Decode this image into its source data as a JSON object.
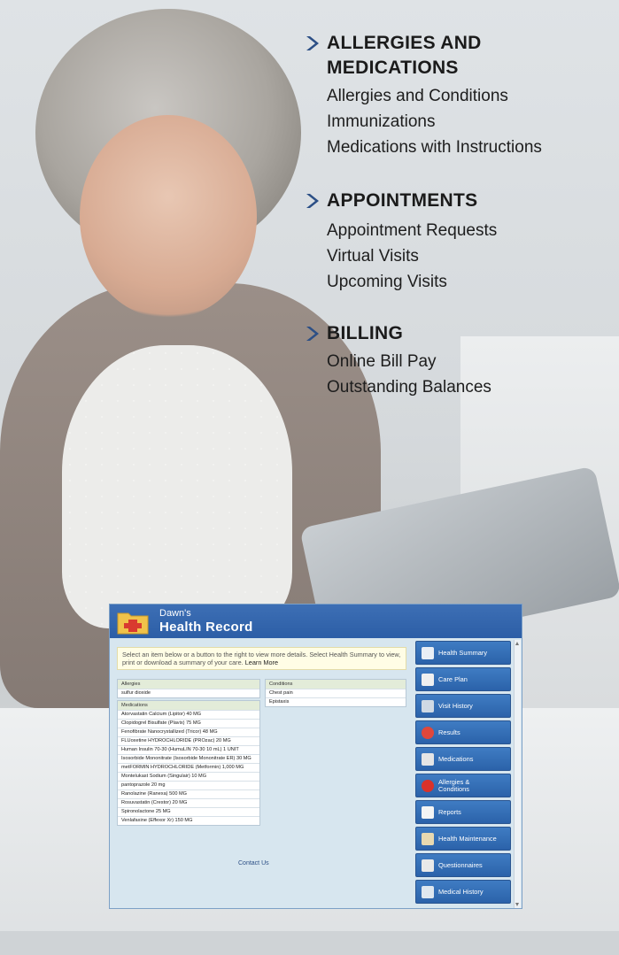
{
  "features": [
    {
      "heading_l1": "ALLERGIES AND",
      "heading_l2": "MEDICATIONS",
      "items": [
        "Allergies and Conditions",
        "Immunizations",
        "Medications with Instructions"
      ]
    },
    {
      "heading_l1": "APPOINTMENTS",
      "heading_l2": "",
      "items": [
        "Appointment Requests",
        "Virtual Visits",
        "Upcoming Visits"
      ]
    },
    {
      "heading_l1": "BILLING",
      "heading_l2": "",
      "items": [
        "Online Bill Pay",
        "Outstanding Balances"
      ]
    }
  ],
  "record": {
    "owner": "Dawn's",
    "title": "Health Record",
    "notice": "Select an item below or a button to the right to view more details. Select Health Summary to view, print or download a summary of your care.",
    "learn_more": "Learn More",
    "allergies": {
      "header": "Allergies",
      "rows": [
        "sulfur dioxide"
      ]
    },
    "conditions": {
      "header": "Conditions",
      "rows": [
        "Chest pain",
        "Epistaxis"
      ]
    },
    "medications": {
      "header": "Medications",
      "rows": [
        "Atorvastatin Calcium (Lipitor) 40 MG",
        "Clopidogrel Bisulfate (Plavix) 75 MG",
        "Fenofibrate Nanocrystallized (Tricor) 48 MG",
        "FLUoxetine HYDROCHLORIDE (PROzac) 20 MG",
        "Human Insulin 70-30 (HumuLIN 70-30 10 mL) 1 UNIT",
        "Isosorbide Mononitrate (Isosorbide Mononitrate ER) 30 MG",
        "metFORMIN HYDROCHLORIDE (Metformin) 1,000 MG",
        "Montelukast Sodium (Singulair) 10 MG",
        "pantoprazole 20 mg",
        "Ranolazine (Ranexa) 500 MG",
        "Rosuvastatin (Crestor) 20 MG",
        "Spironolactone 25 MG",
        "Venlafaxine (Effexor Xr) 150 MG"
      ]
    },
    "contact": "Contact Us",
    "nav": [
      {
        "label": "Health Summary",
        "icon": "book-icon",
        "color": "#e9eef5"
      },
      {
        "label": "Care Plan",
        "icon": "care-plan-icon",
        "color": "#f0f0f0"
      },
      {
        "label": "Visit History",
        "icon": "calendar-icon",
        "color": "#cfd9e4"
      },
      {
        "label": "Results",
        "icon": "results-icon",
        "color": "#e0473b"
      },
      {
        "label": "Medications",
        "icon": "pills-icon",
        "color": "#e5e5e5"
      },
      {
        "label": "Allergies & Conditions",
        "icon": "red-cross-icon",
        "color": "#d9322b"
      },
      {
        "label": "Reports",
        "icon": "report-icon",
        "color": "#f4f4f4"
      },
      {
        "label": "Health Maintenance",
        "icon": "health-maintenance-icon",
        "color": "#e8d9b0"
      },
      {
        "label": "Questionnaires",
        "icon": "questionnaire-icon",
        "color": "#e9e9e9"
      },
      {
        "label": "Medical History",
        "icon": "people-icon",
        "color": "#dfe7ef"
      }
    ]
  }
}
